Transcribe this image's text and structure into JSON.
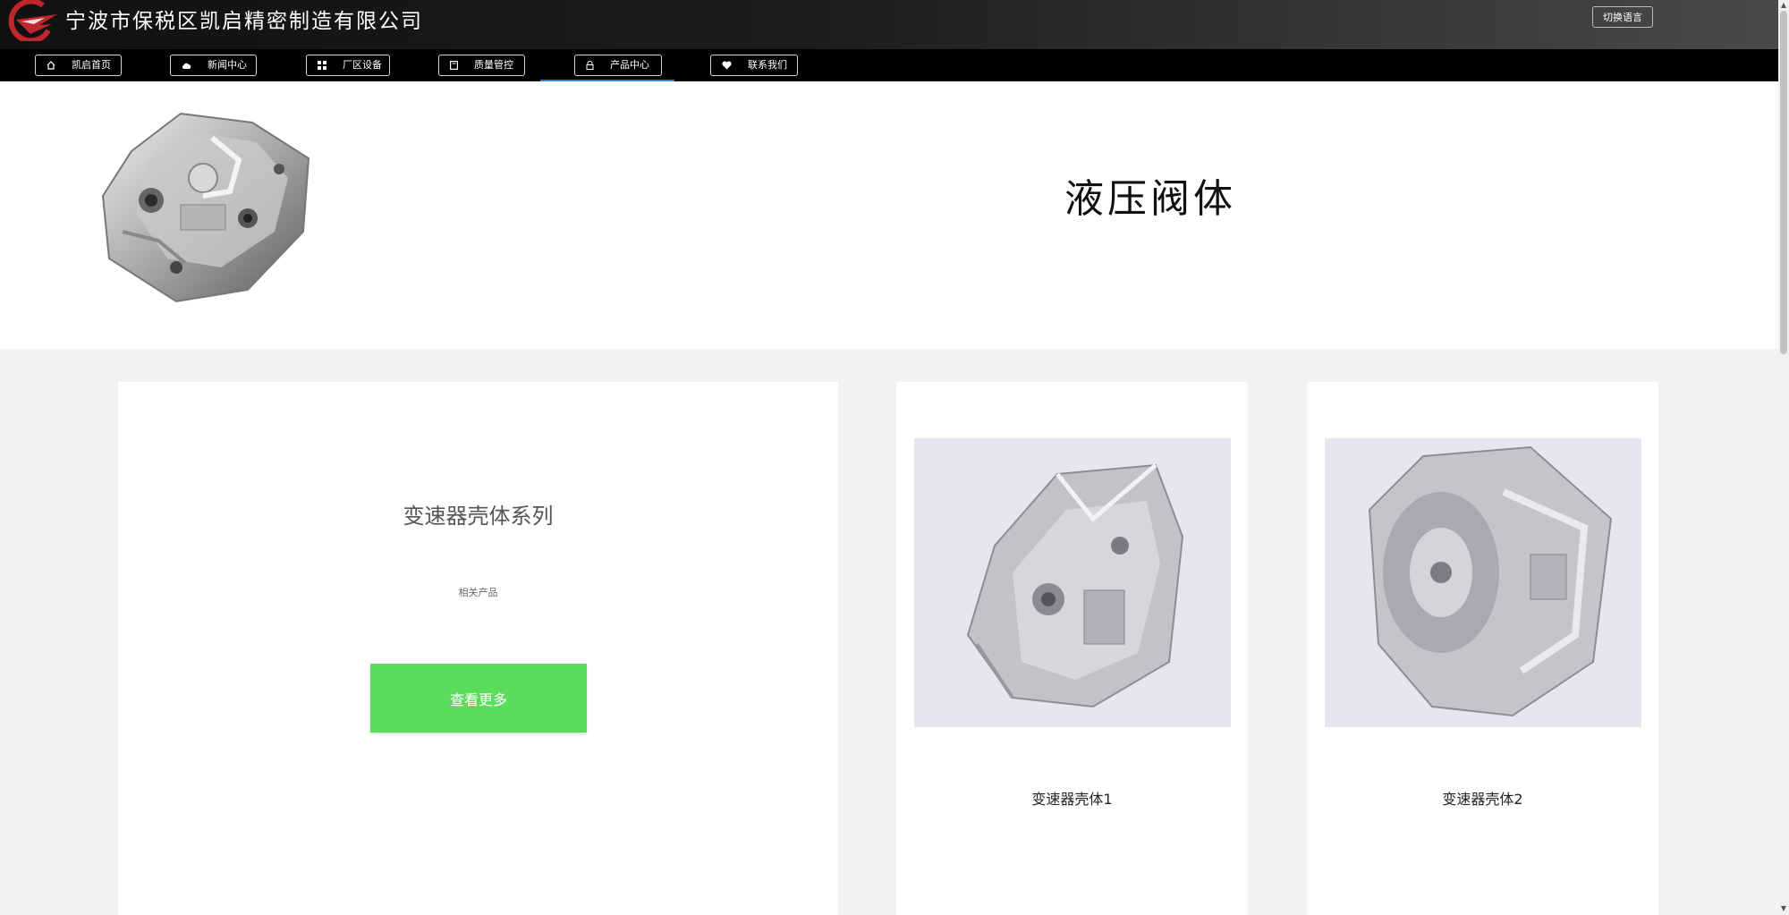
{
  "header": {
    "company_name": "宁波市保税区凯启精密制造有限公司",
    "language_button": "切换语言",
    "brand_color": "#c0262c"
  },
  "nav": {
    "items": [
      {
        "label": "凯启首页",
        "icon": "home-icon"
      },
      {
        "label": "新闻中心",
        "icon": "cloud-icon"
      },
      {
        "label": "厂区设备",
        "icon": "grid-icon"
      },
      {
        "label": "质量管控",
        "icon": "book-icon"
      },
      {
        "label": "产品中心",
        "icon": "lock-icon",
        "active": true
      },
      {
        "label": "联系我们",
        "icon": "heart-icon"
      }
    ],
    "active_color": "#2a7fd6"
  },
  "hero": {
    "title": "液压阀体",
    "image": "hydraulic-valve-body-image"
  },
  "series_card": {
    "title": "变速器壳体系列",
    "subtitle": "相关产品",
    "button_label": "查看更多",
    "button_color": "#5cdc5c"
  },
  "products": [
    {
      "name": "变速器壳体1",
      "image": "transmission-housing-image"
    },
    {
      "name": "变速器壳体2",
      "image": "transmission-housing-image"
    }
  ]
}
